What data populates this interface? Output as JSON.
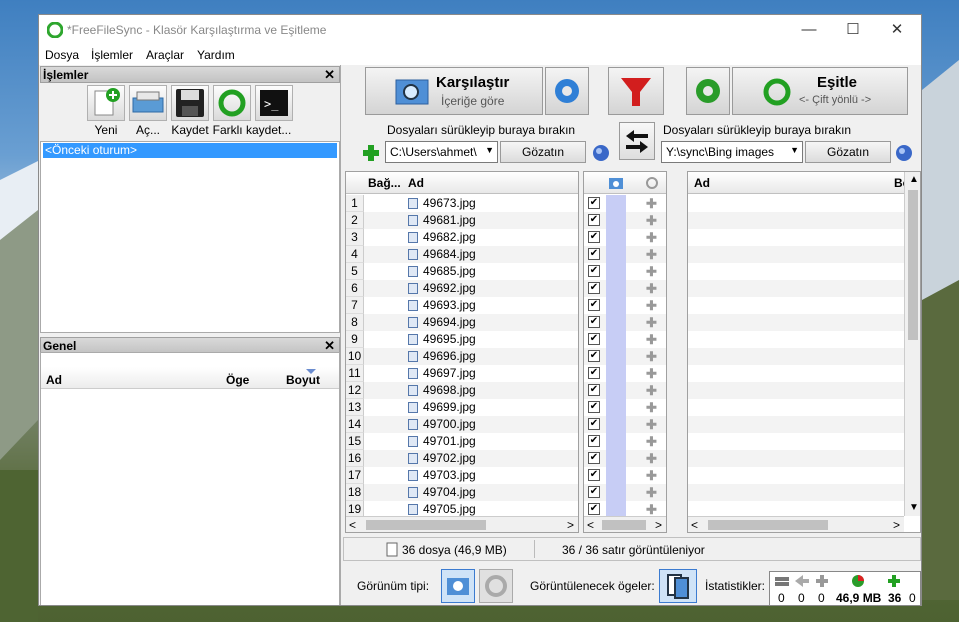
{
  "window": {
    "title": "*FreeFileSync - Klasör Karşılaştırma ve Eşitleme"
  },
  "menu": [
    "Dosya",
    "İşlemler",
    "Araçlar",
    "Yardım"
  ],
  "ops_panel": {
    "title": "İşlemler",
    "close": "✕",
    "buttons": [
      {
        "label": "Yeni",
        "icon": "new-icon"
      },
      {
        "label": "Aç...",
        "icon": "open-icon"
      },
      {
        "label": "Kaydet",
        "icon": "save-icon"
      },
      {
        "label": "Farklı kaydet...",
        "icon": "sync-icon"
      },
      {
        "label": "",
        "icon": "batch-icon"
      }
    ],
    "session": "<Önceki oturum>"
  },
  "general_panel": {
    "title": "Genel",
    "close": "✕",
    "columns": [
      "Ad",
      "Öge",
      "Boyut"
    ]
  },
  "compare": {
    "label": "Karşılaştır",
    "sub": "İçeriğe göre"
  },
  "sync": {
    "label": "Eşitle",
    "sub": "<- Çift yönlü ->"
  },
  "left": {
    "drop_hint": "Dosyaları sürükleyip buraya bırakın",
    "path": "C:\\Users\\ahmet\\",
    "browse": "Gözatın",
    "col_rel": "Bağ...",
    "col_name": "Ad"
  },
  "right": {
    "drop_hint": "Dosyaları sürükleyip buraya bırakın",
    "path": "Y:\\sync\\Bing images",
    "browse": "Gözatın",
    "col_name": "Ad",
    "col_extra": "Bo"
  },
  "rows": [
    {
      "n": "1",
      "file": "49673.jpg"
    },
    {
      "n": "2",
      "file": "49681.jpg"
    },
    {
      "n": "3",
      "file": "49682.jpg"
    },
    {
      "n": "4",
      "file": "49684.jpg"
    },
    {
      "n": "5",
      "file": "49685.jpg"
    },
    {
      "n": "6",
      "file": "49692.jpg"
    },
    {
      "n": "7",
      "file": "49693.jpg"
    },
    {
      "n": "8",
      "file": "49694.jpg"
    },
    {
      "n": "9",
      "file": "49695.jpg"
    },
    {
      "n": "10",
      "file": "49696.jpg"
    },
    {
      "n": "11",
      "file": "49697.jpg"
    },
    {
      "n": "12",
      "file": "49698.jpg"
    },
    {
      "n": "13",
      "file": "49699.jpg"
    },
    {
      "n": "14",
      "file": "49700.jpg"
    },
    {
      "n": "15",
      "file": "49701.jpg"
    },
    {
      "n": "16",
      "file": "49702.jpg"
    },
    {
      "n": "17",
      "file": "49703.jpg"
    },
    {
      "n": "18",
      "file": "49704.jpg"
    },
    {
      "n": "19",
      "file": "49705.jpg"
    }
  ],
  "status": {
    "files": "36 dosya (46,9 MB)",
    "rows": "36 / 36 satır görüntüleniyor"
  },
  "bottom": {
    "view_type": "Görünüm tipi:",
    "show_items": "Görüntülenecek ögeler:",
    "stats": "İstatistikler:",
    "stat_values": [
      "0",
      "0",
      "0",
      "46,9 MB",
      "36",
      "0"
    ]
  },
  "colors": {
    "accent": "#3399ff",
    "check": "#ffffff",
    "compare_col": "#c7cdf5"
  }
}
